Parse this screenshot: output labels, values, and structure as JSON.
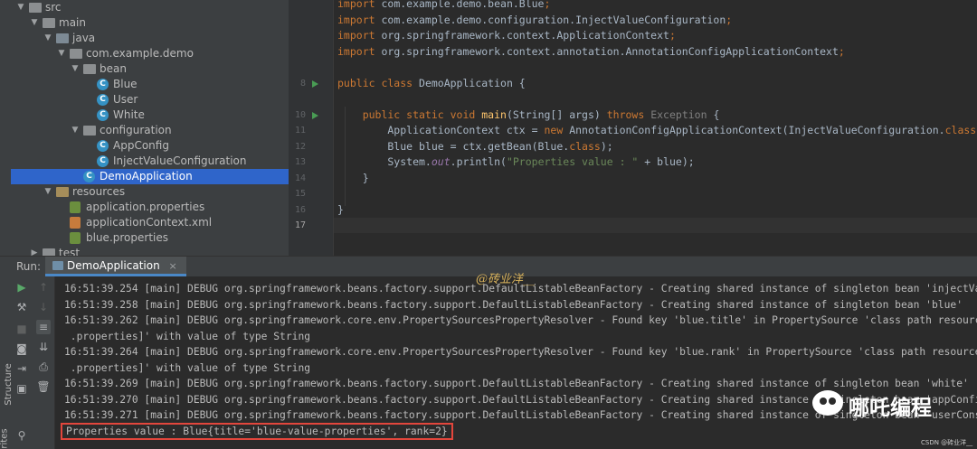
{
  "project_tree": [
    {
      "label": "src",
      "icon": "folder-icon",
      "depth": 2,
      "arrow": "expanded"
    },
    {
      "label": "main",
      "icon": "folder-icon",
      "depth": 3,
      "arrow": "expanded"
    },
    {
      "label": "java",
      "icon": "source-folder-icon",
      "depth": 4,
      "arrow": "expanded"
    },
    {
      "label": "com.example.demo",
      "icon": "package-icon",
      "depth": 5,
      "arrow": "expanded"
    },
    {
      "label": "bean",
      "icon": "package-icon",
      "depth": 6,
      "arrow": "expanded"
    },
    {
      "label": "Blue",
      "icon": "class-icon",
      "depth": 7,
      "arrow": "none"
    },
    {
      "label": "User",
      "icon": "class-icon",
      "depth": 7,
      "arrow": "none"
    },
    {
      "label": "White",
      "icon": "class-icon",
      "depth": 7,
      "arrow": "none"
    },
    {
      "label": "configuration",
      "icon": "package-icon",
      "depth": 6,
      "arrow": "expanded"
    },
    {
      "label": "AppConfig",
      "icon": "class-icon",
      "depth": 7,
      "arrow": "none"
    },
    {
      "label": "InjectValueConfiguration",
      "icon": "class-icon",
      "depth": 7,
      "arrow": "none"
    },
    {
      "label": "DemoApplication",
      "icon": "runnable-class-icon",
      "depth": 6,
      "arrow": "none",
      "selected": true
    },
    {
      "label": "resources",
      "icon": "resources-folder-icon",
      "depth": 4,
      "arrow": "expanded"
    },
    {
      "label": "application.properties",
      "icon": "properties-file-icon",
      "depth": 5,
      "arrow": "none"
    },
    {
      "label": "applicationContext.xml",
      "icon": "xml-file-icon",
      "depth": 5,
      "arrow": "none"
    },
    {
      "label": "blue.properties",
      "icon": "properties-file-icon",
      "depth": 5,
      "arrow": "none"
    },
    {
      "label": "test",
      "icon": "folder-icon",
      "depth": 3,
      "arrow": "collapsed"
    }
  ],
  "editor": {
    "line_numbers": [
      "",
      "",
      "",
      "",
      "",
      "8",
      "",
      "10",
      "11",
      "12",
      "13",
      "14",
      "15",
      "16",
      "17"
    ],
    "current_line": "17",
    "run_gutter_lines": [
      "8",
      "10"
    ],
    "lines": [
      [
        {
          "t": "import ",
          "c": "kw"
        },
        {
          "t": "com.example.demo.bean.Blue",
          "c": ""
        },
        {
          "t": ";",
          "c": "kw"
        }
      ],
      [
        {
          "t": "import ",
          "c": "kw"
        },
        {
          "t": "com.example.demo.configuration.InjectValueConfiguration",
          "c": ""
        },
        {
          "t": ";",
          "c": "kw"
        }
      ],
      [
        {
          "t": "import ",
          "c": "kw"
        },
        {
          "t": "org.springframework.context.ApplicationContext",
          "c": ""
        },
        {
          "t": ";",
          "c": "kw"
        }
      ],
      [
        {
          "t": "import ",
          "c": "kw"
        },
        {
          "t": "org.springframework.context.annotation.AnnotationConfigApplicationContext",
          "c": ""
        },
        {
          "t": ";",
          "c": "kw"
        }
      ],
      [],
      [
        {
          "t": "public class ",
          "c": "kw"
        },
        {
          "t": "DemoApplication {",
          "c": ""
        }
      ],
      [],
      [
        {
          "t": "    public static void ",
          "c": "kw"
        },
        {
          "t": "main",
          "c": "fn"
        },
        {
          "t": "(String[] args) ",
          "c": ""
        },
        {
          "t": "throws ",
          "c": "kw"
        },
        {
          "t": "Exception",
          "c": "gr"
        },
        {
          "t": " {",
          "c": ""
        }
      ],
      [
        {
          "t": "        ApplicationContext ctx = ",
          "c": ""
        },
        {
          "t": "new ",
          "c": "kw"
        },
        {
          "t": "AnnotationConfigApplicationContext(InjectValueConfiguration.",
          "c": ""
        },
        {
          "t": "class",
          "c": "kw"
        },
        {
          "t": ");",
          "c": ""
        }
      ],
      [
        {
          "t": "        Blue blue = ctx.getBean(Blue.",
          "c": ""
        },
        {
          "t": "class",
          "c": "kw"
        },
        {
          "t": ");",
          "c": ""
        }
      ],
      [
        {
          "t": "        System.",
          "c": ""
        },
        {
          "t": "out",
          "c": "st"
        },
        {
          "t": ".println(",
          "c": ""
        },
        {
          "t": "\"Properties value : \"",
          "c": "str"
        },
        {
          "t": " + blue);",
          "c": ""
        }
      ],
      [
        {
          "t": "    }",
          "c": ""
        }
      ],
      [],
      [
        {
          "t": "}",
          "c": ""
        }
      ],
      []
    ]
  },
  "run_panel": {
    "label": "Run:",
    "tab_label": "DemoApplication",
    "tab_close": "×"
  },
  "console": {
    "lines": [
      "16:51:39.254 [main] DEBUG org.springframework.beans.factory.support.DefaultListableBeanFactory - Creating shared instance of singleton bean 'injectValu",
      "16:51:39.258 [main] DEBUG org.springframework.beans.factory.support.DefaultListableBeanFactory - Creating shared instance of singleton bean 'blue'",
      "16:51:39.262 [main] DEBUG org.springframework.core.env.PropertySourcesPropertyResolver - Found key 'blue.title' in PropertySource 'class path resource",
      " .properties]' with value of type String",
      "16:51:39.264 [main] DEBUG org.springframework.core.env.PropertySourcesPropertyResolver - Found key 'blue.rank' in PropertySource 'class path resource [",
      " .properties]' with value of type String",
      "16:51:39.269 [main] DEBUG org.springframework.beans.factory.support.DefaultListableBeanFactory - Creating shared instance of singleton bean 'white'",
      "16:51:39.270 [main] DEBUG org.springframework.beans.factory.support.DefaultListableBeanFactory - Creating shared instance of singleton bean 'appConfig'",
      "16:51:39.271 [main] DEBUG org.springframework.beans.factory.support.DefaultListableBeanFactory - Creating shared instance of singleton bean 'userConstr"
    ],
    "result": "Properties value : Blue{title='blue-value-properties', rank=2}"
  },
  "side_labels": {
    "structure": "Structure",
    "favorites": "rites"
  },
  "watermarks": {
    "author": "@砖业洋__",
    "brand": "哪吒编程",
    "csdn": "CSDN @砖业洋__"
  },
  "colors": {
    "accent": "#2f65ca",
    "run_green": "#499c54",
    "highlight_red": "#e2463c",
    "keyword": "#cc7832",
    "string": "#6a8759"
  }
}
